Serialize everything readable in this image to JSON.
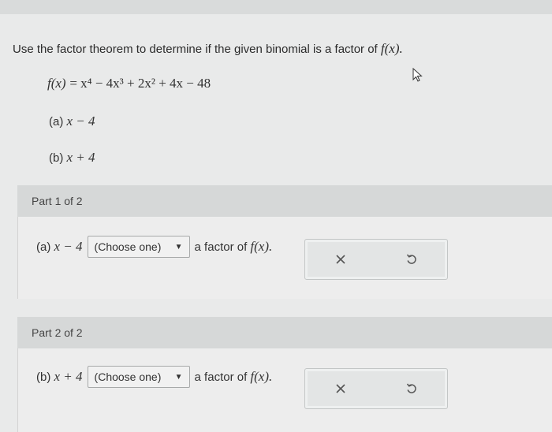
{
  "question": {
    "prompt": "Use the factor theorem to determine if the given binomial is a factor of",
    "fx": "f(x)."
  },
  "function": {
    "lhs": "f(x)",
    "rhs": "= x⁴ − 4x³ + 2x² + 4x − 48"
  },
  "choices": [
    {
      "label": "(a)",
      "expr": "x − 4"
    },
    {
      "label": "(b)",
      "expr": "x + 4"
    }
  ],
  "parts": [
    {
      "title": "Part 1 of 2",
      "label": "(a)",
      "expr": "x − 4",
      "select_value": "(Choose one)",
      "suffix": "a factor of",
      "fx": "f(x)."
    },
    {
      "title": "Part 2 of 2",
      "label": "(b)",
      "expr": "x + 4",
      "select_value": "(Choose one)",
      "suffix": "a factor of",
      "fx": "f(x)."
    }
  ],
  "icons": {
    "clear": "close-icon",
    "undo": "undo-icon",
    "caret": "caret-down-icon",
    "cursor": "mouse-pointer-icon"
  },
  "colors": {
    "background": "#e9eaea",
    "header": "#d6d8d8",
    "icon": "#555555"
  }
}
